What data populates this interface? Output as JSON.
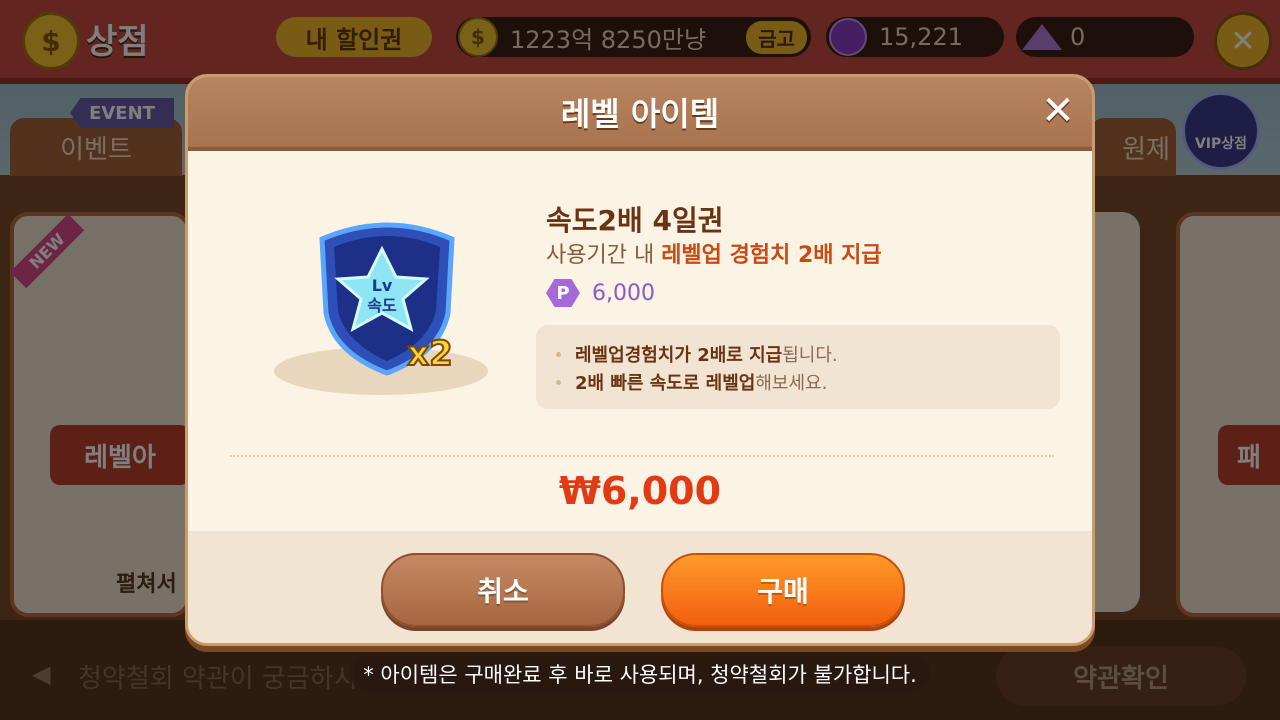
{
  "header": {
    "shop_title": "상점",
    "coin_symbol": "$",
    "coupon_label": "내 할인권",
    "money": "1223억 8250만냥",
    "vault_label": "금고",
    "gems": "15,221",
    "crystals": "0",
    "close_symbol": "✕"
  },
  "background": {
    "event_badge": "EVENT",
    "tab_event": "이벤트",
    "tab_right": "원제",
    "vip_label": "VIP상점",
    "new_ribbon": "NEW",
    "left_card_label": "레벨아",
    "left_card_sub": "펼쳐서",
    "right_card_label": "패",
    "notice_text": "청약철회 약관이 궁금하시",
    "terms_button": "약관확인"
  },
  "modal": {
    "title": "레벨 아이템",
    "close_symbol": "✕",
    "item_name": "속도2배 4일권",
    "item_desc_prefix": "사용기간 내 ",
    "item_desc_highlight": "레벨업 경험치 2배 지급",
    "price_badge": "P",
    "price_points": "6,000",
    "icon_text_line1": "Lv",
    "icon_text_line2": "속도",
    "icon_multiplier": "x2",
    "info_lines": [
      {
        "bold": "레벨업 ",
        "bold2": "경험치가 2배로 지급",
        "normal": "됩니다."
      },
      {
        "bold": "2배 빠른 속도로 레벨업 ",
        "bold2": "",
        "normal": "해보세요."
      }
    ],
    "total_price": "₩6,000",
    "cancel_button": "취소",
    "buy_button": "구매"
  },
  "toast": "* 아이템은 구매완료 후 바로 사용되며, 청약철회가 불가합니다.",
  "colors": {
    "accent_orange": "#f25f0e",
    "price_red": "#e23a14",
    "header_brown": "#a8734f"
  }
}
